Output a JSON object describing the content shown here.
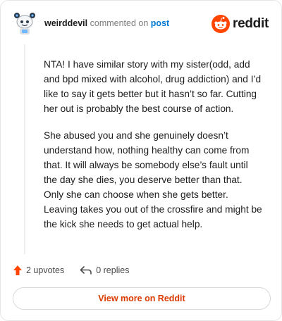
{
  "header": {
    "username": "weirddevil",
    "verb": "commented on",
    "post_link": "post",
    "brand": "reddit",
    "brand_color": "#ff4500"
  },
  "comment": {
    "paragraphs": [
      "NTA! I have similar story with my sister(odd, add and bpd mixed with alcohol, drug addiction) and I’d like to say it gets better but it hasn’t so far. Cutting her out is probably the best course of action.",
      "She abused you and she genuinely doesn’t understand how, nothing healthy can come from that. It will always be somebody else’s fault until the day she dies, you deserve better than that. Only she can choose when she gets better. Leaving takes you out of the crossfire and might be the kick she needs to get actual help."
    ]
  },
  "actions": {
    "upvotes": "2 upvotes",
    "replies": "0 replies",
    "upvote_icon": "upvote-arrow-icon",
    "reply_icon": "reply-arrow-icon"
  },
  "footer": {
    "view_button": "View more on Reddit",
    "accent_color": "#d93a00"
  }
}
